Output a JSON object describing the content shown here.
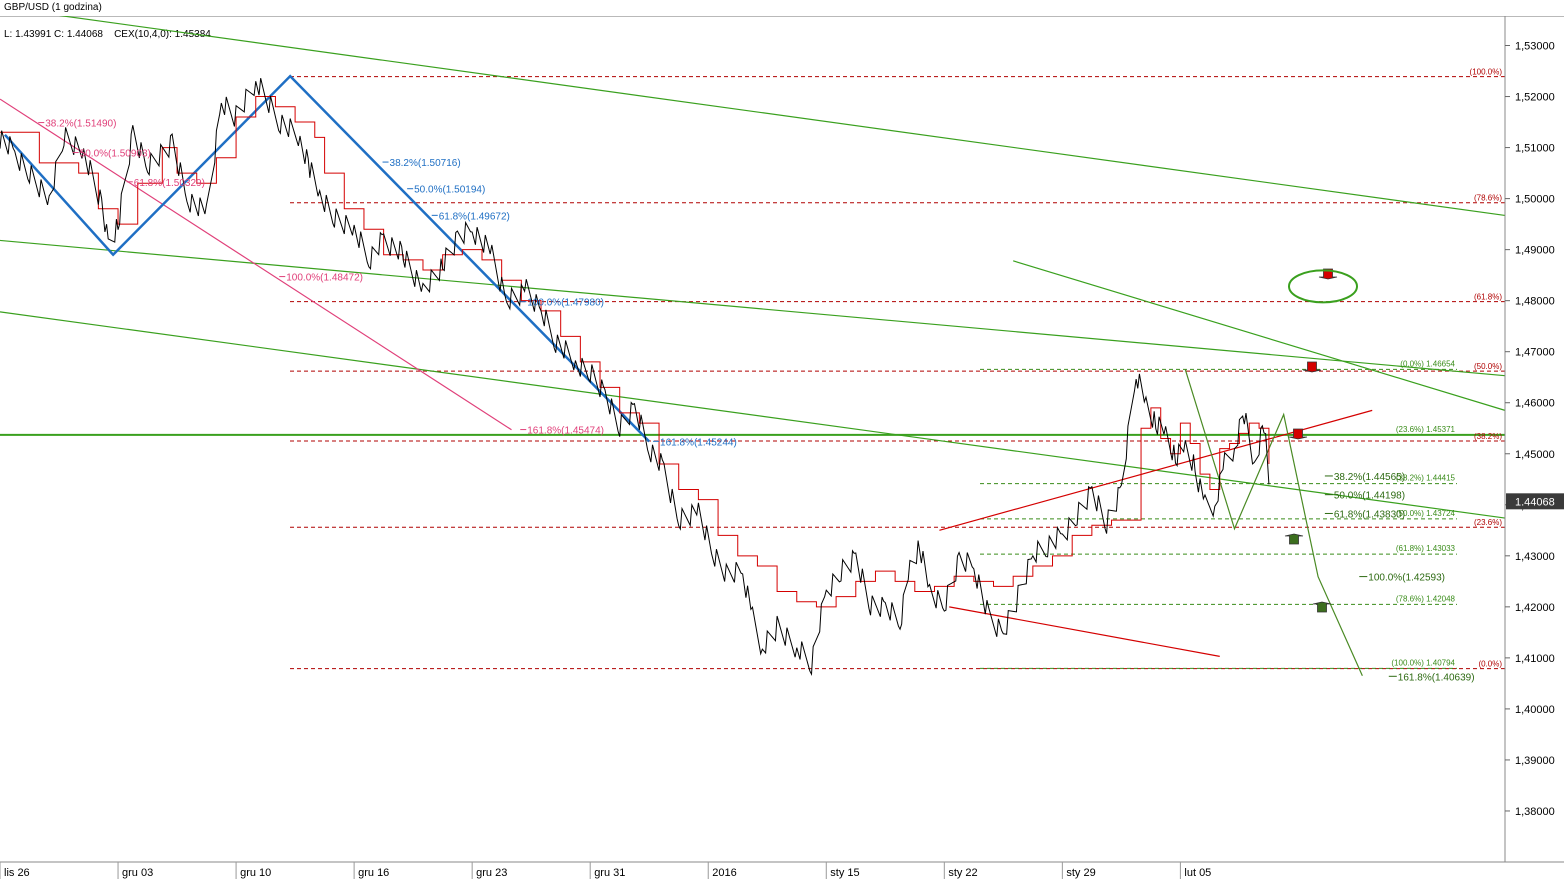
{
  "header": {
    "title": "GBP/USD (1 godzina)",
    "legend": "L: 1.43991 C: 1.44068    CEX(10,4,0): 1.45384"
  },
  "price_marker": "1.44068",
  "colors": {
    "price": "#000000",
    "indicator": "#d40000",
    "trend": "#3aa01e",
    "fib_blue": "#1f6fc4",
    "fib_pink": "#e0407a",
    "fib_red_levels": "#b00000",
    "fib_green_levels": "#3a8c1a",
    "arrow_down": "#d40000",
    "arrow_up": "#3c6e1e"
  },
  "chart_data": {
    "type": "line",
    "ylim": [
      1.37,
      1.535
    ],
    "yticks": [
      "1,53000",
      "1,52000",
      "1,51000",
      "1,50000",
      "1,49000",
      "1,48000",
      "1,47000",
      "1,46000",
      "1,45000",
      "1,44000",
      "1,43000",
      "1,42000",
      "1,41000",
      "1,40000",
      "1,39000",
      "1,38000"
    ],
    "ytick_values": [
      1.53,
      1.52,
      1.51,
      1.5,
      1.49,
      1.48,
      1.47,
      1.46,
      1.45,
      1.44,
      1.43,
      1.42,
      1.41,
      1.4,
      1.39,
      1.38
    ],
    "xticks": [
      "lis 26",
      "gru 03",
      "gru 10",
      "gru 16",
      "gru 23",
      "gru 31",
      "2016",
      "sty 15",
      "sty 22",
      "sty 29",
      "lut 05"
    ],
    "xtick_index": [
      0,
      24,
      48,
      72,
      96,
      120,
      144,
      168,
      192,
      216,
      240
    ],
    "price_series": {
      "name": "GBP/USD",
      "index": [
        0,
        3,
        6,
        10,
        13,
        17,
        21,
        22,
        24,
        27,
        30,
        35,
        38,
        42,
        45,
        48,
        52,
        57,
        61,
        63,
        65,
        68,
        72,
        75,
        78,
        82,
        86,
        90,
        93,
        96,
        100,
        103,
        107,
        110,
        113,
        117,
        120,
        123,
        126,
        129,
        132,
        135,
        138,
        142,
        145,
        148,
        151,
        153,
        155,
        158,
        162,
        165,
        168,
        171,
        174,
        177,
        180,
        183,
        185,
        187,
        189,
        192,
        195,
        198,
        201,
        204,
        207,
        210,
        213,
        216,
        219,
        222,
        225,
        228,
        231,
        233,
        235,
        237,
        239,
        241,
        243,
        245,
        247,
        249,
        251,
        253,
        255,
        257,
        258
      ],
      "values": [
        1.512,
        1.509,
        1.505,
        1.5,
        1.512,
        1.509,
        1.498,
        1.491,
        1.495,
        1.513,
        1.506,
        1.511,
        1.5,
        1.497,
        1.519,
        1.516,
        1.523,
        1.515,
        1.512,
        1.506,
        1.501,
        1.496,
        1.494,
        1.488,
        1.492,
        1.489,
        1.482,
        1.487,
        1.492,
        1.494,
        1.489,
        1.48,
        1.482,
        1.478,
        1.472,
        1.468,
        1.466,
        1.462,
        1.455,
        1.459,
        1.451,
        1.447,
        1.437,
        1.439,
        1.43,
        1.426,
        1.427,
        1.418,
        1.412,
        1.416,
        1.412,
        1.409,
        1.423,
        1.427,
        1.43,
        1.42,
        1.42,
        1.417,
        1.428,
        1.432,
        1.423,
        1.42,
        1.429,
        1.428,
        1.418,
        1.415,
        1.422,
        1.43,
        1.432,
        1.434,
        1.438,
        1.443,
        1.436,
        1.443,
        1.466,
        1.46,
        1.456,
        1.454,
        1.449,
        1.451,
        1.447,
        1.44,
        1.44,
        1.448,
        1.451,
        1.458,
        1.448,
        1.456,
        1.444
      ]
    },
    "indicator_series": {
      "name": "CEX(10,4,0)",
      "index": [
        0,
        8,
        16,
        20,
        24,
        28,
        33,
        36,
        40,
        44,
        48,
        52,
        56,
        60,
        64,
        66,
        70,
        74,
        78,
        82,
        86,
        90,
        94,
        98,
        102,
        106,
        110,
        114,
        118,
        122,
        126,
        130,
        134,
        138,
        142,
        146,
        150,
        154,
        158,
        162,
        166,
        170,
        174,
        178,
        182,
        186,
        190,
        194,
        198,
        202,
        206,
        210,
        214,
        218,
        222,
        226,
        230,
        232,
        234,
        236,
        238,
        240,
        242,
        244,
        246,
        248,
        250,
        252,
        254,
        256,
        258
      ],
      "values": [
        1.513,
        1.507,
        1.505,
        1.498,
        1.495,
        1.503,
        1.51,
        1.505,
        1.503,
        1.508,
        1.516,
        1.52,
        1.518,
        1.515,
        1.512,
        1.505,
        1.498,
        1.494,
        1.489,
        1.488,
        1.486,
        1.489,
        1.49,
        1.488,
        1.484,
        1.48,
        1.478,
        1.473,
        1.468,
        1.463,
        1.458,
        1.456,
        1.448,
        1.443,
        1.441,
        1.434,
        1.43,
        1.428,
        1.423,
        1.421,
        1.42,
        1.422,
        1.425,
        1.427,
        1.425,
        1.423,
        1.424,
        1.426,
        1.425,
        1.424,
        1.426,
        1.428,
        1.43,
        1.434,
        1.436,
        1.437,
        1.437,
        1.455,
        1.459,
        1.453,
        1.45,
        1.456,
        1.452,
        1.446,
        1.443,
        1.451,
        1.452,
        1.454,
        1.456,
        1.455,
        1.448
      ]
    },
    "fib_red_levels": [
      {
        "label": "(100.0%)",
        "value": 1.5239
      },
      {
        "label": "(78.6%)",
        "value": 1.4992
      },
      {
        "label": "(61.8%)",
        "value": 1.4798
      },
      {
        "label": "(50.0%)",
        "value": 1.4662
      },
      {
        "label": "(38.2%)",
        "value": 1.4525
      },
      {
        "label": "(23.6%)",
        "value": 1.4356
      },
      {
        "label": "(0.0%)",
        "value": 1.4079
      }
    ],
    "fib_green_levels": [
      {
        "label": "(0.0%) 1.46654",
        "value": 1.46654
      },
      {
        "label": "(23.6%) 1.45371",
        "value": 1.45371
      },
      {
        "label": "(38.2%) 1.44415",
        "value": 1.44415
      },
      {
        "label": "(50.0%) 1.43724",
        "value": 1.43724
      },
      {
        "label": "(61.8%) 1.43033",
        "value": 1.43033
      },
      {
        "label": "(78.6%) 1.42048",
        "value": 1.42048
      },
      {
        "label": "(100.0%) 1.40794",
        "value": 1.40794
      }
    ],
    "fib_blue_labels": [
      {
        "label": "38.2%(1.50716)",
        "value": 1.50716
      },
      {
        "label": "50.0%(1.50194)",
        "value": 1.50194
      },
      {
        "label": "61.8%(1.49672)",
        "value": 1.49672
      },
      {
        "label": "100.0%(1.47980)",
        "value": 1.4798
      },
      {
        "label": "161.8%(1.45244)",
        "value": 1.45244
      }
    ],
    "fib_pink_labels": [
      {
        "label": "38.2%(1.51490)",
        "value": 1.5149
      },
      {
        "label": "50.0%(1.50903)",
        "value": 1.50903
      },
      {
        "label": "61.8%(1.50329)",
        "value": 1.50329
      },
      {
        "label": "100.0%(1.48472)",
        "value": 1.48472
      },
      {
        "label": "161.8%(1.45474)",
        "value": 1.45474
      }
    ],
    "fib_right_labels": [
      {
        "label": "38.2%(1.44565)",
        "value": 1.44565
      },
      {
        "label": "50.0%(1.44198)",
        "value": 1.44198
      },
      {
        "label": "61.8%(1.43830)",
        "value": 1.4383
      },
      {
        "label": "100.0%(1.42593)",
        "value": 1.42593
      },
      {
        "label": "161.8%(1.40639)",
        "value": 1.40639
      }
    ],
    "horizontal_level": 1.4537
  }
}
